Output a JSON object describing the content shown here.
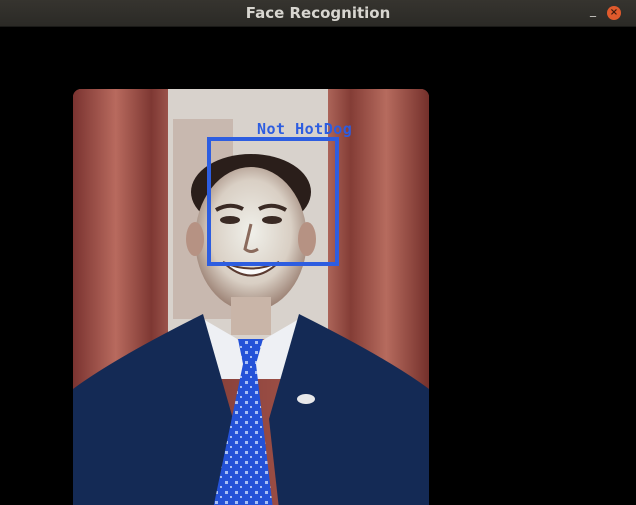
{
  "window": {
    "title": "Face Recognition",
    "minimize_glyph": "_",
    "close_glyph": "×"
  },
  "detection": {
    "label": "Not HotDog",
    "box_color": "#2d5de0"
  },
  "icons": {
    "minimize": "minimize-icon",
    "close": "close-icon"
  }
}
